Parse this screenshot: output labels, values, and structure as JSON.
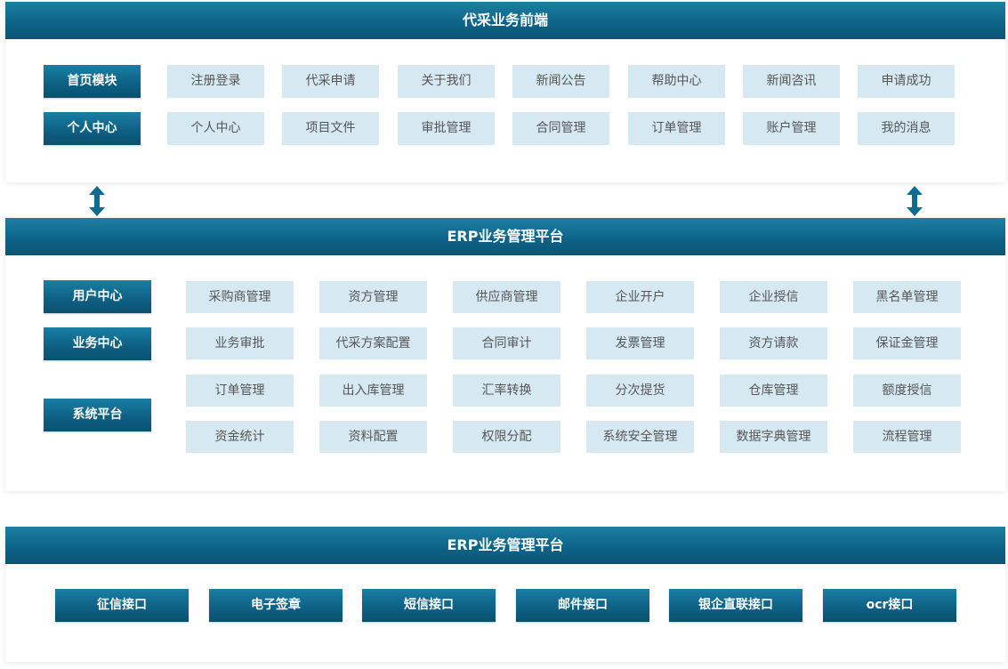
{
  "colors": {
    "header_start": "#1d7fa3",
    "header_end": "#0b5474",
    "light_button": "#d6e9f3",
    "arrow": "#0f6c91"
  },
  "icons": [
    "double-arrow-icon"
  ],
  "frontend": {
    "title": "代采业务前端",
    "rows": [
      {
        "category": "首页模块",
        "items": [
          "注册登录",
          "代采申请",
          "关于我们",
          "新闻公告",
          "帮助中心",
          "新闻咨讯",
          "申请成功"
        ]
      },
      {
        "category": "个人中心",
        "items": [
          "个人中心",
          "项目文件",
          "审批管理",
          "合同管理",
          "订单管理",
          "账户管理",
          "我的消息"
        ]
      }
    ]
  },
  "erp": {
    "title": "ERP业务管理平台",
    "categories": [
      "用户中心",
      "业务中心",
      "系统平台"
    ],
    "grid": [
      [
        "采购商管理",
        "资方管理",
        "供应商管理",
        "企业开户",
        "企业授信",
        "黑名单管理"
      ],
      [
        "业务审批",
        "代采方案配置",
        "合同审计",
        "发票管理",
        "资方请款",
        "保证金管理"
      ],
      [
        "订单管理",
        "出入库管理",
        "汇率转换",
        "分次提货",
        "仓库管理",
        "额度授信"
      ],
      [
        "资金统计",
        "资料配置",
        "权限分配",
        "系统安全管理",
        "数据字典管理",
        "流程管理"
      ]
    ]
  },
  "interfaces": {
    "title": "ERP业务管理平台",
    "items": [
      "征信接口",
      "电子签章",
      "短信接口",
      "邮件接口",
      "银企直联接口",
      "ocr接口"
    ]
  }
}
